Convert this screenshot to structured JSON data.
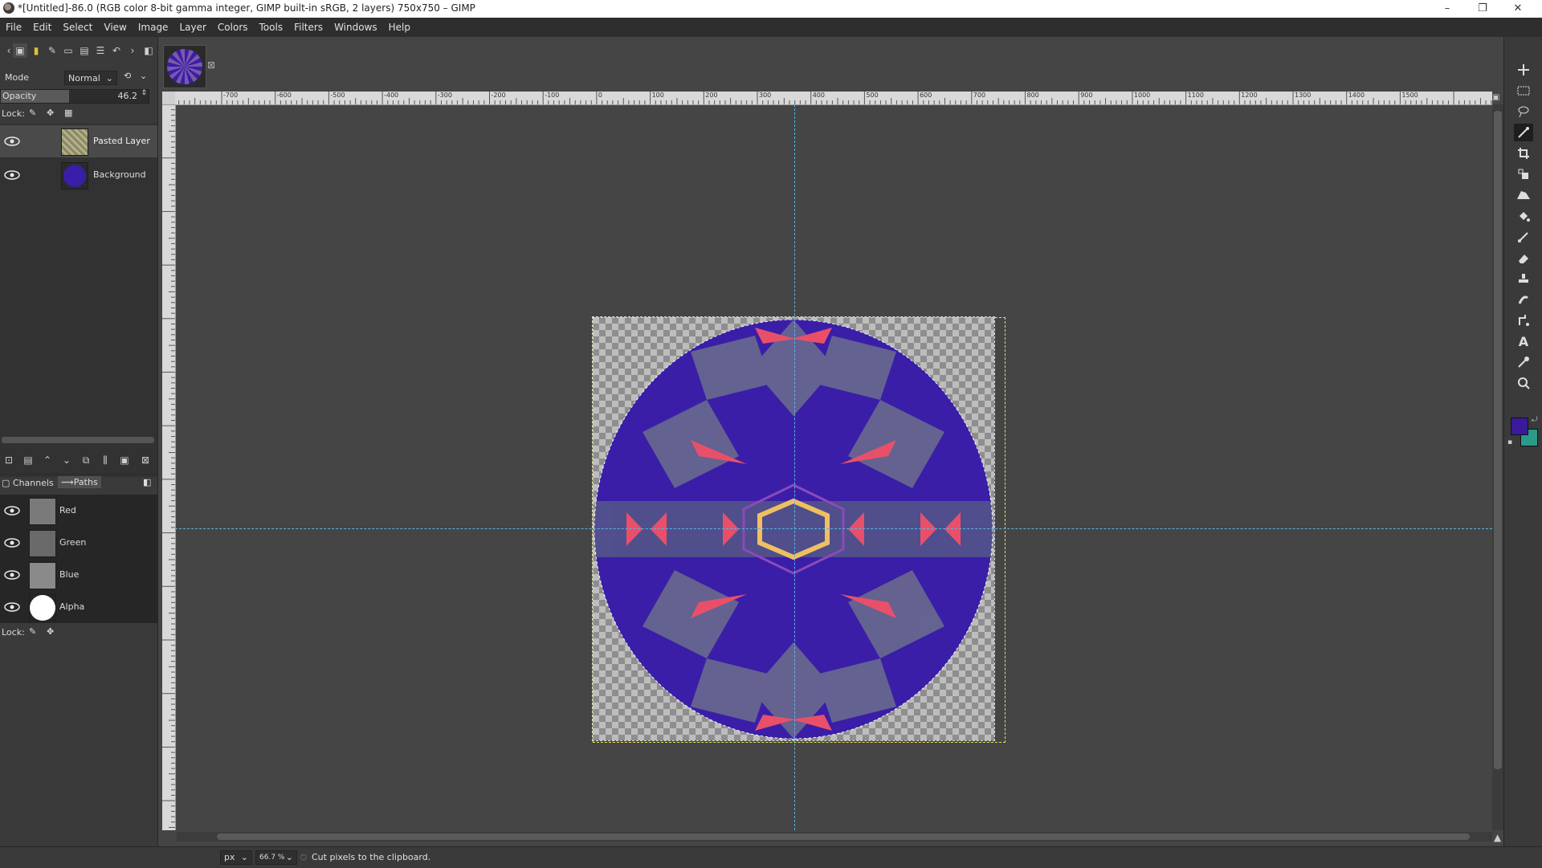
{
  "window": {
    "title": "*[Untitled]-86.0 (RGB color 8-bit gamma integer, GIMP built-in sRGB, 2 layers) 750x750 – GIMP",
    "minimize": "–",
    "maximize": "❐",
    "close": "✕"
  },
  "menu": [
    "File",
    "Edit",
    "Select",
    "View",
    "Image",
    "Layer",
    "Colors",
    "Tools",
    "Filters",
    "Windows",
    "Help"
  ],
  "layers_panel": {
    "mode_label": "Mode",
    "mode_value": "Normal",
    "opacity_label": "Opacity",
    "opacity_value": "46.2",
    "opacity_fraction": 0.462,
    "lock_label": "Lock:",
    "layers": [
      {
        "name": "Pasted Layer",
        "visible": true,
        "selected": true
      },
      {
        "name": "Background",
        "visible": true,
        "selected": false
      }
    ]
  },
  "channels_panel": {
    "tabs": [
      "Channels",
      "Paths"
    ],
    "channels": [
      {
        "name": "Red",
        "thumb": "#7a7a7a"
      },
      {
        "name": "Green",
        "thumb": "#6a6a6a"
      },
      {
        "name": "Blue",
        "thumb": "#8a8a8a"
      },
      {
        "name": "Alpha",
        "thumb": "#ffffff"
      }
    ],
    "lock_label": "Lock:"
  },
  "ruler_labels": [
    "-700",
    "-600",
    "-500",
    "-400",
    "-300",
    "-200",
    "-100",
    "0",
    "100",
    "200",
    "300",
    "400",
    "500",
    "600",
    "700",
    "800",
    "900",
    "1000",
    "1100",
    "1200",
    "1300",
    "1400",
    "1500"
  ],
  "status": {
    "unit": "px",
    "zoom": "66.7 %",
    "message": "Cut pixels to the clipboard."
  },
  "colors": {
    "fg": "#3a1a9a",
    "bg": "#2a9a8a",
    "guide": "#5ab6e6",
    "pattern_primary": "#3a1ea8",
    "pattern_accent": "#e8506a"
  }
}
